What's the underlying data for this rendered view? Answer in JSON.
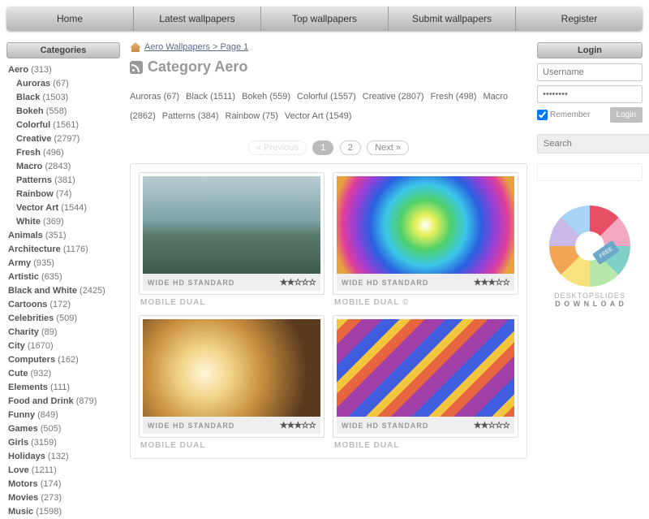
{
  "nav": [
    "Home",
    "Latest wallpapers",
    "Top wallpapers",
    "Submit wallpapers",
    "Register"
  ],
  "sidebarTitle": "Categories",
  "cats": [
    {
      "n": "Aero",
      "c": "313"
    },
    {
      "n": "Auroras",
      "c": "67",
      "sub": 1
    },
    {
      "n": "Black",
      "c": "1503",
      "sub": 1
    },
    {
      "n": "Bokeh",
      "c": "558",
      "sub": 1
    },
    {
      "n": "Colorful",
      "c": "1561",
      "sub": 1
    },
    {
      "n": "Creative",
      "c": "2797",
      "sub": 1
    },
    {
      "n": "Fresh",
      "c": "496",
      "sub": 1
    },
    {
      "n": "Macro",
      "c": "2843",
      "sub": 1
    },
    {
      "n": "Patterns",
      "c": "381",
      "sub": 1
    },
    {
      "n": "Rainbow",
      "c": "74",
      "sub": 1
    },
    {
      "n": "Vector Art",
      "c": "1544",
      "sub": 1
    },
    {
      "n": "White",
      "c": "369",
      "sub": 1
    },
    {
      "n": "Animals",
      "c": "351"
    },
    {
      "n": "Architecture",
      "c": "1176"
    },
    {
      "n": "Army",
      "c": "935"
    },
    {
      "n": "Artistic",
      "c": "635"
    },
    {
      "n": "Black and White",
      "c": "2425"
    },
    {
      "n": "Cartoons",
      "c": "172"
    },
    {
      "n": "Celebrities",
      "c": "509"
    },
    {
      "n": "Charity",
      "c": "89"
    },
    {
      "n": "City",
      "c": "1670"
    },
    {
      "n": "Computers",
      "c": "162"
    },
    {
      "n": "Cute",
      "c": "932"
    },
    {
      "n": "Elements",
      "c": "111"
    },
    {
      "n": "Food and Drink",
      "c": "879"
    },
    {
      "n": "Funny",
      "c": "849"
    },
    {
      "n": "Games",
      "c": "505"
    },
    {
      "n": "Girls",
      "c": "3159"
    },
    {
      "n": "Holidays",
      "c": "132"
    },
    {
      "n": "Love",
      "c": "1211"
    },
    {
      "n": "Motors",
      "c": "174"
    },
    {
      "n": "Movies",
      "c": "273"
    },
    {
      "n": "Music",
      "c": "1598"
    }
  ],
  "breadcrumb": "Aero Wallpapers > Page 1",
  "pageTitle": "Category Aero",
  "subcats": [
    {
      "n": "Auroras",
      "c": "67"
    },
    {
      "n": "Black",
      "c": "1511"
    },
    {
      "n": "Bokeh",
      "c": "559"
    },
    {
      "n": "Colorful",
      "c": "1557"
    },
    {
      "n": "Creative",
      "c": "2807"
    },
    {
      "n": "Fresh",
      "c": "498"
    },
    {
      "n": "Macro",
      "c": "2862"
    },
    {
      "n": "Patterns",
      "c": "384"
    },
    {
      "n": "Rainbow",
      "c": "75"
    },
    {
      "n": "Vector Art",
      "c": "1549"
    }
  ],
  "pager": {
    "prev": "« Previous",
    "next": "Next »",
    "pages": [
      "1",
      "2"
    ],
    "cur": 0
  },
  "thumbBar": "WIDE HD STANDARD",
  "cards": [
    {
      "cap": "MOBILE DUAL",
      "stars": "★★☆☆☆",
      "bg": "linear-gradient(180deg,#b9cdd2 0%,#7fa3a8 45%,#5c7a6b 60%,#3e5a4c 100%)"
    },
    {
      "cap": "MOBILE DUAL ©",
      "stars": "★★★☆☆",
      "bg": "radial-gradient(circle at 50% 50%,#ffffffcc,#e8f05a 10%,#4fd06b 25%,#3bc7e8 40%,#2a5fe0 55%,#9a3fd6 70%,#e03f9a 82%,#e8a13f 92%)"
    },
    {
      "cap": "MOBILE DUAL",
      "stars": "★★★☆☆",
      "bg": "radial-gradient(circle at 35% 55%,#fff6d9,#f2d489 20%,#c98f3f 45%,#5a3a1f 80%)"
    },
    {
      "cap": "MOBILE DUAL",
      "stars": "★★☆☆☆",
      "bg": "repeating-linear-gradient(135deg,#f2c73f 0 10px,#e8663f 10px 22px,#a33fa8 22px 40px,#3f5fe0 40px 55px)"
    }
  ],
  "loginTitle": "Login",
  "login": {
    "userPh": "Username",
    "passVal": "••••••••",
    "remember": "Remember",
    "btn": "Login"
  },
  "searchPh": "Search",
  "promo": {
    "tag": "FREE",
    "l1": "DESKTOPSLIDES",
    "l2": "D O W N L O A D"
  }
}
